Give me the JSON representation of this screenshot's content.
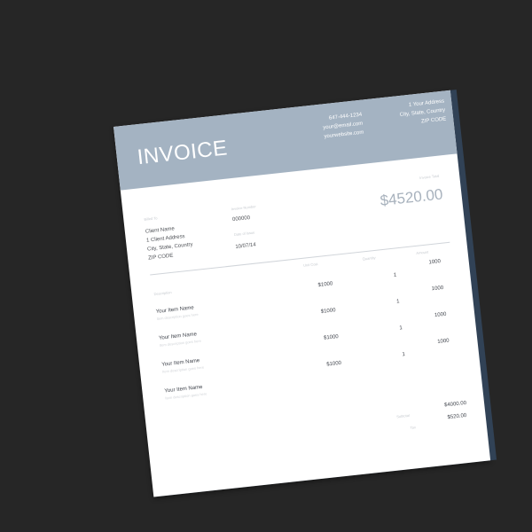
{
  "invoice": {
    "title": "INVOICE",
    "contact": {
      "phone": "647-444-1234",
      "email": "your@email.com",
      "website": "yourwebsite.com"
    },
    "company_address": {
      "line1": "1 Your Address",
      "line2": "City, State, Country",
      "line3": "ZIP CODE"
    },
    "billed_to": {
      "label": "Billed To",
      "name": "Client Name",
      "address": "1 Client Address",
      "city": "City, State, Country",
      "zip": "ZIP CODE"
    },
    "invoice_number": {
      "label": "Invoice Number",
      "value": "000000"
    },
    "date_of_issue": {
      "label": "Date of Issue",
      "value": "10/07/14"
    },
    "invoice_total": {
      "label": "Invoice Total",
      "value": "$4520.00"
    },
    "table": {
      "headings": {
        "description": "Description",
        "unit_cost": "Unit Cost",
        "quantity": "Quantity",
        "amount": "Amount"
      },
      "items": [
        {
          "name": "Your Item Name",
          "description": "Item description goes here",
          "price": "$1000",
          "quantity": "1",
          "total": "1000"
        },
        {
          "name": "Your Item Name",
          "description": "Item description goes here",
          "price": "$1000",
          "quantity": "1",
          "total": "1000"
        },
        {
          "name": "Your Item Name",
          "description": "Item description goes here",
          "price": "$1000",
          "quantity": "1",
          "total": "1000"
        },
        {
          "name": "Your Item Name",
          "description": "Item description goes here",
          "price": "$1000",
          "quantity": "1",
          "total": "1000"
        }
      ]
    },
    "summary": {
      "subtotal_label": "Subtotal",
      "subtotal_value": "$4000.00",
      "tax_label": "Tax",
      "tax_value": "$520.00"
    }
  }
}
